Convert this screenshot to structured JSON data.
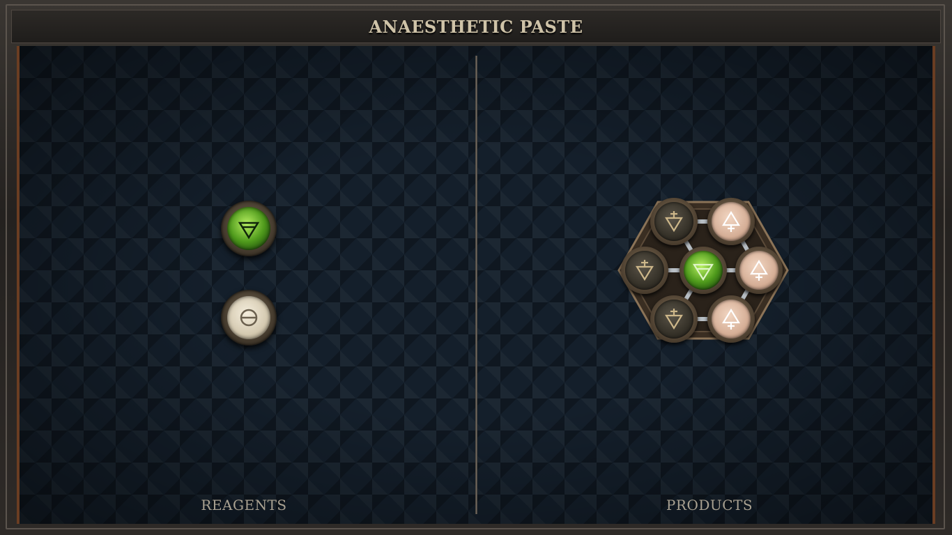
{
  "title": "ANAESTHETIC PASTE",
  "reagents_label": "REAGENTS",
  "products_label": "PRODUCTS",
  "reagents": [
    {
      "element": "earth",
      "icon": "earth-symbol-icon",
      "color": "#6fc22a"
    },
    {
      "element": "salt",
      "icon": "salt-symbol-icon",
      "color": "#e2d9c2"
    }
  ],
  "product": {
    "atoms": [
      {
        "element": "earth",
        "icon": "earth-symbol-icon"
      },
      {
        "element": "water",
        "icon": "water-symbol-icon"
      },
      {
        "element": "water",
        "icon": "water-symbol-icon"
      },
      {
        "element": "water",
        "icon": "water-symbol-icon"
      },
      {
        "element": "fire",
        "icon": "fire-symbol-icon"
      },
      {
        "element": "fire",
        "icon": "fire-symbol-icon"
      },
      {
        "element": "fire",
        "icon": "fire-symbol-icon"
      }
    ]
  },
  "colors": {
    "title_text": "#cfc3a8",
    "board_bg": "#141f2b",
    "label_text": "#a9a191",
    "frame_accent": "#6a3d22"
  }
}
